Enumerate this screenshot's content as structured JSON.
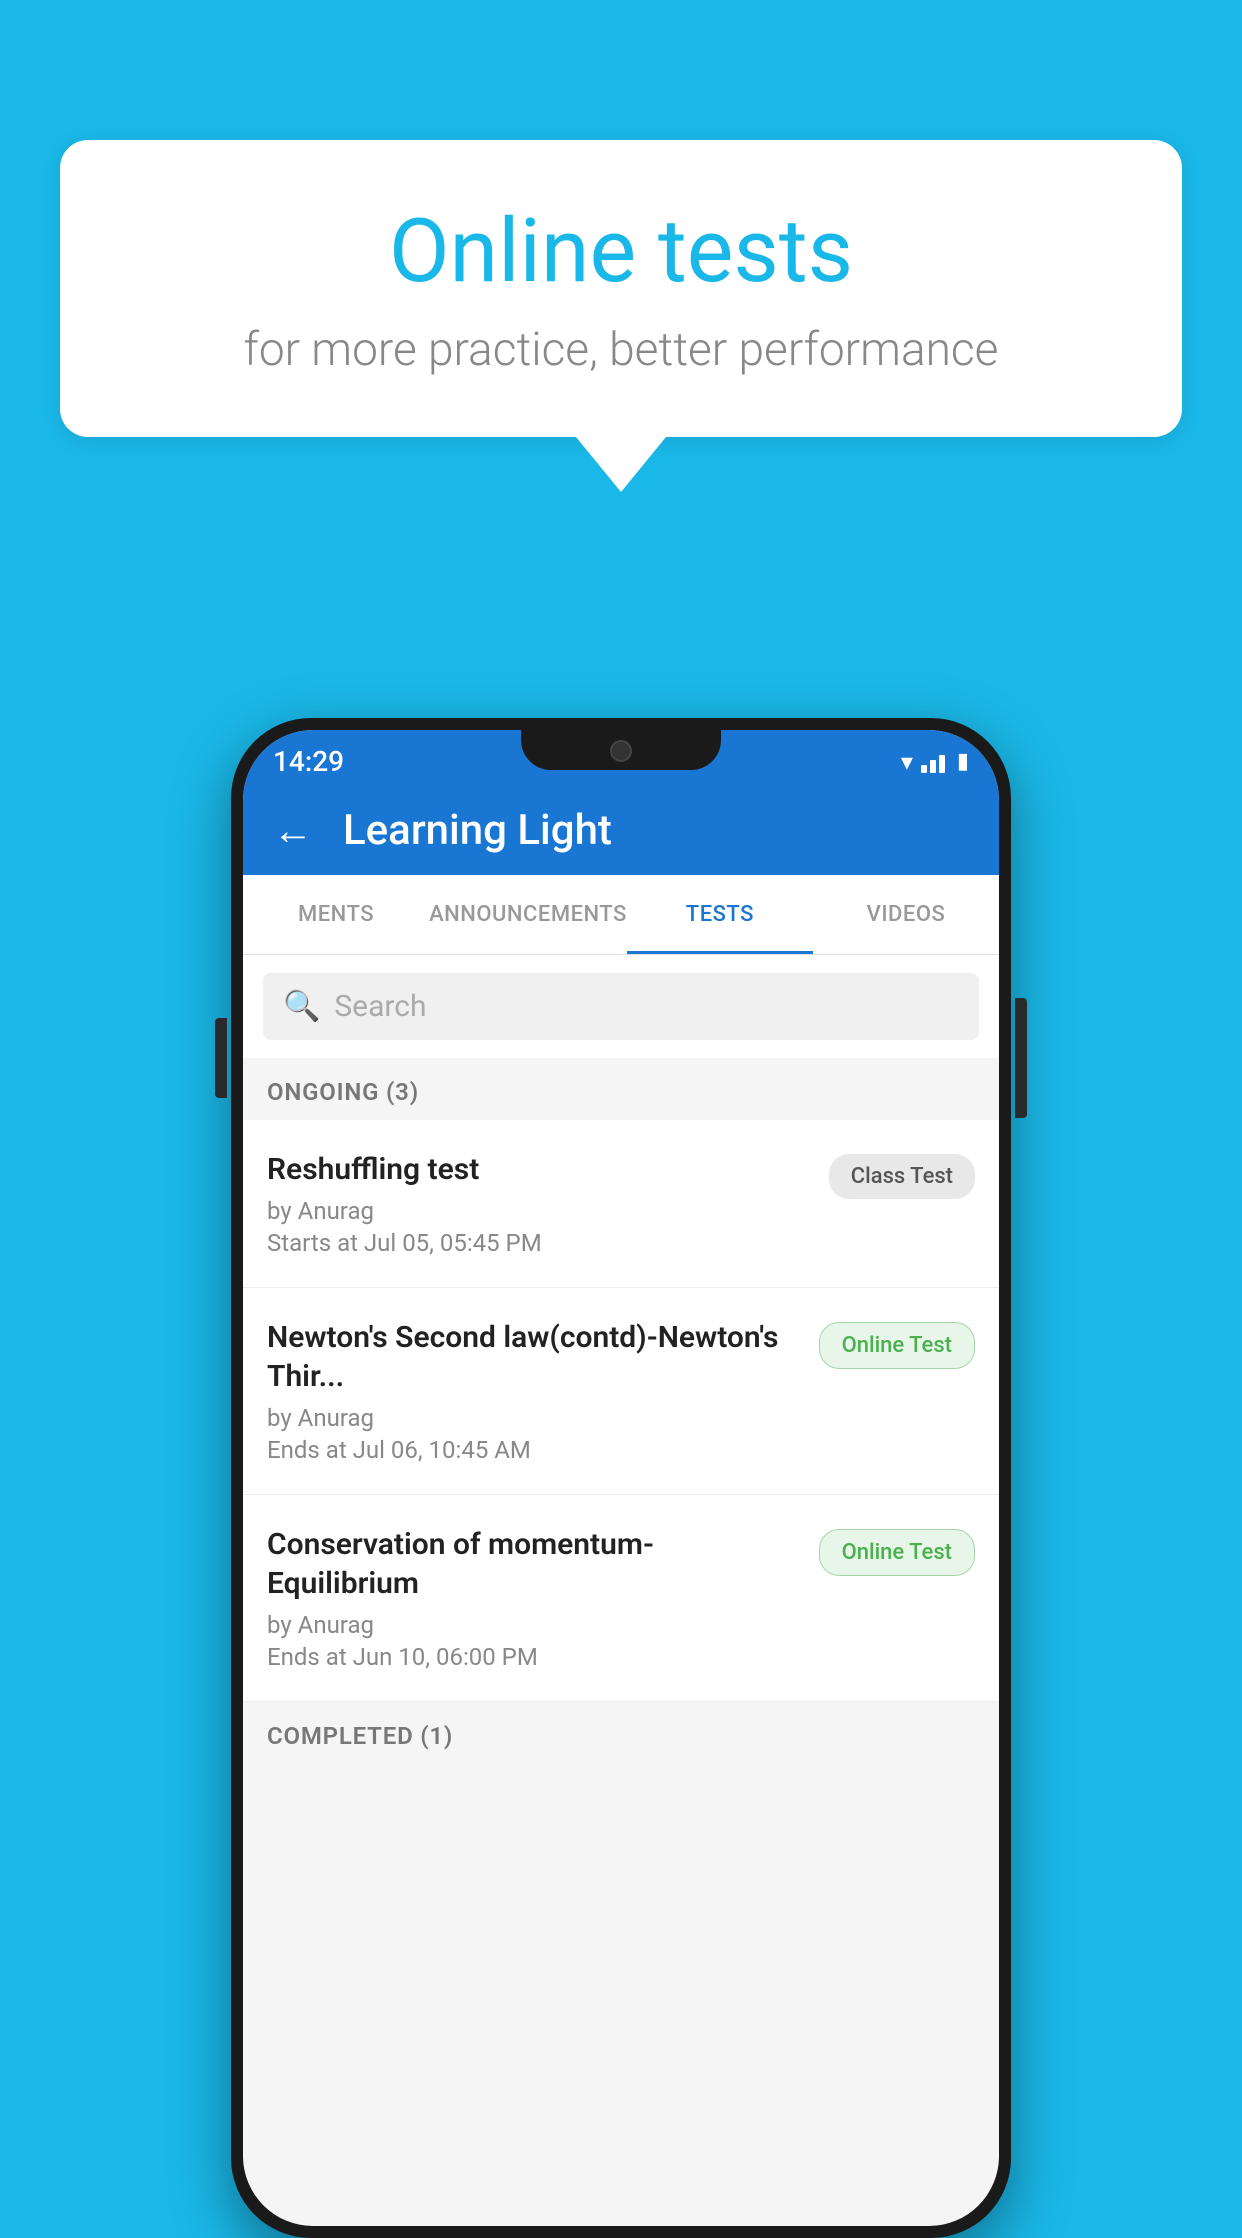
{
  "background": {
    "color": "#1ab8e8"
  },
  "speech_bubble": {
    "title": "Online tests",
    "subtitle": "for more practice, better performance"
  },
  "phone": {
    "status_bar": {
      "time": "14:29"
    },
    "app_header": {
      "title": "Learning Light",
      "back_label": "←"
    },
    "tabs": [
      {
        "label": "MENTS",
        "active": false
      },
      {
        "label": "ANNOUNCEMENTS",
        "active": false
      },
      {
        "label": "TESTS",
        "active": true
      },
      {
        "label": "VIDEOS",
        "active": false
      }
    ],
    "search": {
      "placeholder": "Search"
    },
    "sections": [
      {
        "title": "ONGOING (3)",
        "tests": [
          {
            "name": "Reshuffling test",
            "by": "by Anurag",
            "date": "Starts at  Jul 05, 05:45 PM",
            "badge": "Class Test",
            "badge_type": "class"
          },
          {
            "name": "Newton's Second law(contd)-Newton's Thir...",
            "by": "by Anurag",
            "date": "Ends at  Jul 06, 10:45 AM",
            "badge": "Online Test",
            "badge_type": "online"
          },
          {
            "name": "Conservation of momentum-Equilibrium",
            "by": "by Anurag",
            "date": "Ends at  Jun 10, 06:00 PM",
            "badge": "Online Test",
            "badge_type": "online"
          }
        ]
      }
    ],
    "completed_section": {
      "title": "COMPLETED (1)"
    }
  }
}
